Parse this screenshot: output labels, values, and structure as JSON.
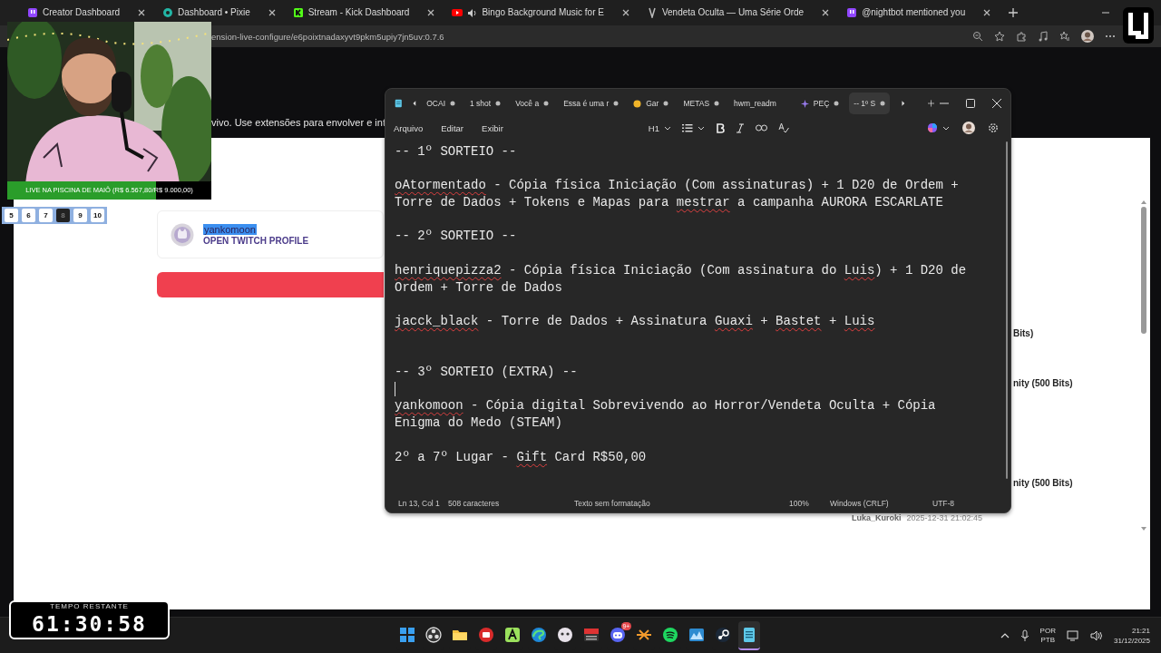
{
  "browser": {
    "tabs": [
      {
        "title": "Creator Dashboard"
      },
      {
        "title": "Dashboard • Pixie"
      },
      {
        "title": "Stream - Kick Dashboard"
      },
      {
        "title": "Bingo Background Music for E"
      },
      {
        "title": "Vendeta Oculta — Uma Série Orde"
      },
      {
        "title": "@nightbot mentioned you"
      }
    ],
    "url": "ension-live-configure/e6poixtnadaxyvt9pkm5upiy7jn5uv:0.7.6"
  },
  "page": {
    "description": "vivo. Use extensões para envolver e int",
    "profile": {
      "name": "yankomoon",
      "highlighted": true,
      "link": "OPEN TWITCH PROFILE"
    },
    "right_fragments": [
      "Bits)",
      "nity (500 Bits)",
      "nity (500 Bits)"
    ],
    "entry": {
      "user": "Luka_Kuroki",
      "time": "2025-12-31 21:02:45"
    }
  },
  "webcam": {
    "kind": "picture",
    "goal": {
      "label": "LIVE NA PISCINA DE MAIÔ (R$ 6.567,80/R$ 9.000,00)",
      "level": 0.73
    }
  },
  "number_tabs": [
    {
      "label": "5",
      "selected": false
    },
    {
      "label": "6",
      "selected": false
    },
    {
      "label": "7",
      "selected": false
    },
    {
      "label": "8",
      "selected": true
    },
    {
      "label": "9",
      "selected": false
    },
    {
      "label": "10",
      "selected": false
    }
  ],
  "timer": {
    "title": "TEMPO RESTANTE",
    "value": "61:30:58"
  },
  "notepad": {
    "tabs": [
      {
        "title": "OCAI",
        "modified": true,
        "selected": false
      },
      {
        "title": "1 shot",
        "modified": true,
        "selected": false
      },
      {
        "title": "Você a",
        "modified": true,
        "selected": false
      },
      {
        "title": "Essa é uma r",
        "modified": true,
        "selected": false
      },
      {
        "title": "Gar",
        "modified": true,
        "selected": false
      },
      {
        "title": "METAS",
        "modified": true,
        "selected": false
      },
      {
        "title": "hwm_readm",
        "modified": false,
        "selected": false
      },
      {
        "title": "PEÇ",
        "modified": true,
        "selected": false
      },
      {
        "title": "-- 1º S",
        "modified": true,
        "selected": true
      }
    ],
    "menu": [
      "Arquivo",
      "Editar",
      "Exibir"
    ],
    "heading": "H1",
    "lines": [
      {
        "kind": "text",
        "segments": [
          {
            "text": "-- 1º SORTEIO --",
            "misspelled": false
          }
        ]
      },
      {
        "kind": "blank"
      },
      {
        "kind": "text",
        "segments": [
          {
            "text": "oAtormentado",
            "misspelled": true
          },
          {
            "text": " - Cópia física Iniciação (Com assinaturas) + 1 D20 de Ordem + Torre de Dados + Tokens e Mapas para ",
            "misspelled": false
          },
          {
            "text": "mestrar",
            "misspelled": true
          },
          {
            "text": " a campanha AURORA ESCARLATE",
            "misspelled": false
          }
        ]
      },
      {
        "kind": "blank"
      },
      {
        "kind": "text",
        "segments": [
          {
            "text": "-- 2º SORTEIO --",
            "misspelled": false
          }
        ]
      },
      {
        "kind": "blank"
      },
      {
        "kind": "text",
        "segments": [
          {
            "text": "henriquepizza2",
            "misspelled": true
          },
          {
            "text": " - Cópia física Iniciação (Com assinatura do ",
            "misspelled": false
          },
          {
            "text": "Luis",
            "misspelled": true
          },
          {
            "text": ") + 1 D20 de Ordem + Torre de Dados",
            "misspelled": false
          }
        ]
      },
      {
        "kind": "blank"
      },
      {
        "kind": "text",
        "segments": [
          {
            "text": "jacck_black",
            "misspelled": true
          },
          {
            "text": " - Torre de Dados + Assinatura ",
            "misspelled": false
          },
          {
            "text": "Guaxi",
            "misspelled": true
          },
          {
            "text": " + ",
            "misspelled": false
          },
          {
            "text": "Bastet",
            "misspelled": true
          },
          {
            "text": " + ",
            "misspelled": false
          },
          {
            "text": "Luis",
            "misspelled": true
          }
        ]
      },
      {
        "kind": "blank"
      },
      {
        "kind": "blank"
      },
      {
        "kind": "text",
        "segments": [
          {
            "text": "-- 3º SORTEIO (EXTRA) --",
            "misspelled": false
          }
        ]
      },
      {
        "kind": "cursor"
      },
      {
        "kind": "text",
        "segments": [
          {
            "text": "yankomoon",
            "misspelled": true
          },
          {
            "text": " - Cópia digital Sobrevivendo ao Horror/Vendeta Oculta + Cópia Enigma do Medo (STEAM)",
            "misspelled": false
          }
        ]
      },
      {
        "kind": "blank"
      },
      {
        "kind": "text",
        "segments": [
          {
            "text": "2º a 7º Lugar - ",
            "misspelled": false
          },
          {
            "text": "Gift",
            "misspelled": true
          },
          {
            "text": " Card R$50,00",
            "misspelled": false
          }
        ]
      }
    ],
    "status": [
      "Ln 13, Col 1",
      "508 caracteres",
      "Texto sem formatação",
      "100%",
      "Windows (CRLF)",
      "UTF-8"
    ]
  },
  "taskbar": {
    "apps": [
      {
        "active": false
      },
      {
        "active": false
      },
      {
        "active": false
      },
      {
        "active": false
      },
      {
        "active": false
      },
      {
        "active": false
      },
      {
        "active": false
      },
      {
        "active": false
      },
      {
        "active": false,
        "badge": "9+"
      },
      {
        "active": false
      },
      {
        "active": false
      },
      {
        "active": false
      },
      {
        "active": false
      },
      {
        "active": true
      }
    ],
    "language": "POR",
    "layout": "PTB",
    "time": "21:21",
    "date": "31/12/2025"
  }
}
